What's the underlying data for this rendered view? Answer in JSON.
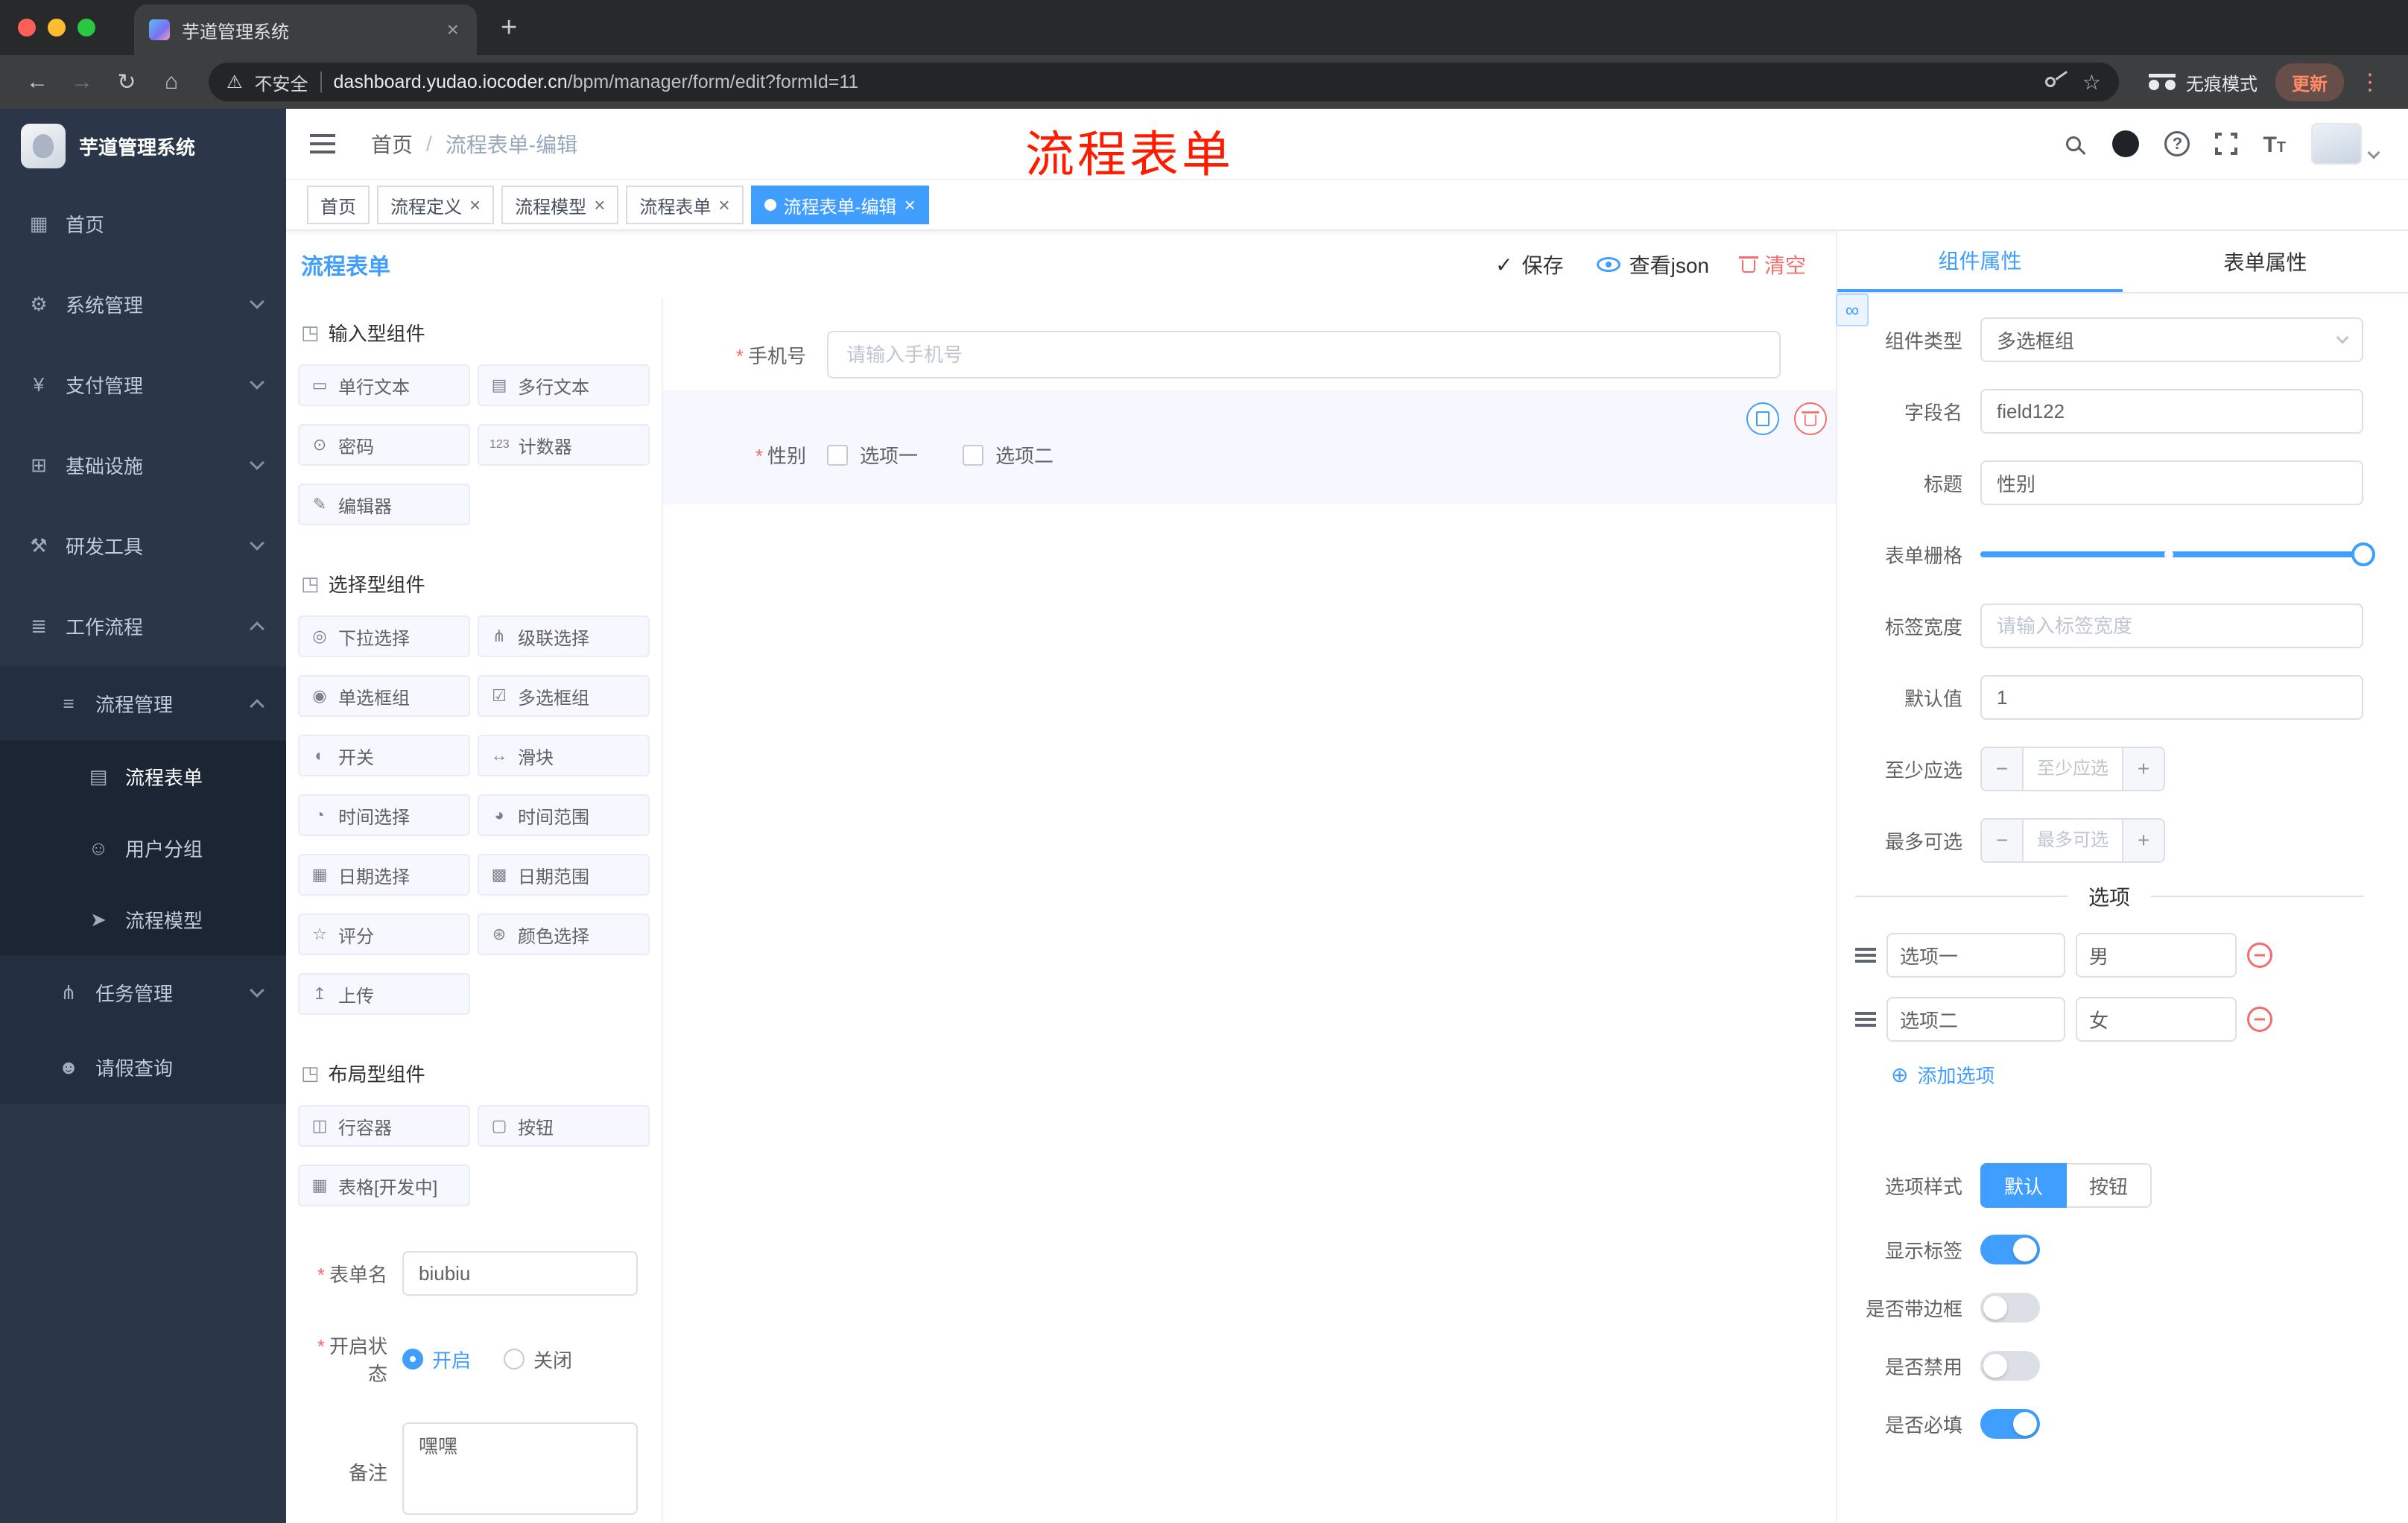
{
  "colors": {
    "accent": "#409EFF",
    "danger": "#F56C6C",
    "annotation_red": "#FE1B00"
  },
  "browser": {
    "tab_title": "芋道管理系统",
    "security_label": "不安全",
    "url_domain": "dashboard.yudao.iocoder.cn",
    "url_path": "/bpm/manager/form/edit?formId=11",
    "incognito_label": "无痕模式",
    "update_label": "更新"
  },
  "sidebar": {
    "brand": "芋道管理系统",
    "items": [
      {
        "label": "首页",
        "glyph": "▦"
      },
      {
        "label": "系统管理",
        "glyph": "⚙"
      },
      {
        "label": "支付管理",
        "glyph": "¥"
      },
      {
        "label": "基础设施",
        "glyph": "⊞"
      },
      {
        "label": "研发工具",
        "glyph": "⚒"
      },
      {
        "label": "工作流程",
        "glyph": "≣"
      },
      {
        "label": "流程管理",
        "glyph": "≡"
      },
      {
        "label": "流程表单",
        "glyph": "▤"
      },
      {
        "label": "用户分组",
        "glyph": "☺"
      },
      {
        "label": "流程模型",
        "glyph": "➤"
      },
      {
        "label": "任务管理",
        "glyph": "⋔"
      },
      {
        "label": "请假查询",
        "glyph": "☻"
      }
    ]
  },
  "header": {
    "breadcrumb_home": "首页",
    "breadcrumb_current": "流程表单-编辑",
    "annotation": "流程表单"
  },
  "tags": [
    {
      "label": "首页"
    },
    {
      "label": "流程定义"
    },
    {
      "label": "流程模型"
    },
    {
      "label": "流程表单"
    },
    {
      "label": "流程表单-编辑"
    }
  ],
  "designer": {
    "title": "流程表单",
    "save_label": "保存",
    "view_json_label": "查看json",
    "clear_label": "清空",
    "groups": [
      {
        "title": "输入型组件",
        "items": [
          {
            "label": "单行文本",
            "glyph": "▭"
          },
          {
            "label": "多行文本",
            "glyph": "▤"
          },
          {
            "label": "密码",
            "glyph": "⊙"
          },
          {
            "label": "计数器",
            "glyph": "123"
          },
          {
            "label": "编辑器",
            "glyph": "✎"
          }
        ]
      },
      {
        "title": "选择型组件",
        "items": [
          {
            "label": "下拉选择",
            "glyph": "◎"
          },
          {
            "label": "级联选择",
            "glyph": "⋔"
          },
          {
            "label": "单选框组",
            "glyph": "◉"
          },
          {
            "label": "多选框组",
            "glyph": "☑"
          },
          {
            "label": "开关",
            "glyph": "◐"
          },
          {
            "label": "滑块",
            "glyph": "↔"
          },
          {
            "label": "时间选择",
            "glyph": "◔"
          },
          {
            "label": "时间范围",
            "glyph": "◕"
          },
          {
            "label": "日期选择",
            "glyph": "▦"
          },
          {
            "label": "日期范围",
            "glyph": "▩"
          },
          {
            "label": "评分",
            "glyph": "☆"
          },
          {
            "label": "颜色选择",
            "glyph": "⊛"
          },
          {
            "label": "上传",
            "glyph": "↥"
          }
        ]
      },
      {
        "title": "布局型组件",
        "items": [
          {
            "label": "行容器",
            "glyph": "◫"
          },
          {
            "label": "按钮",
            "glyph": "▢"
          },
          {
            "label": "表格[开发中]",
            "glyph": "▦"
          }
        ]
      }
    ],
    "meta": {
      "name_label": "表单名",
      "name_value": "biubiu",
      "status_label": "开启状态",
      "status_on": "开启",
      "status_off": "关闭",
      "remark_label": "备注",
      "remark_value": "嘿嘿"
    },
    "canvas": {
      "phone_label": "手机号",
      "phone_placeholder": "请输入手机号",
      "gender_label": "性别",
      "gender_option1": "选项一",
      "gender_option2": "选项二"
    }
  },
  "props": {
    "tab_component": "组件属性",
    "tab_form": "表单属性",
    "component_type_label": "组件类型",
    "component_type_value": "多选框组",
    "field_name_label": "字段名",
    "field_name_value": "field122",
    "title_label": "标题",
    "title_value": "性别",
    "grid_label": "表单栅格",
    "label_width_label": "标签宽度",
    "label_width_placeholder": "请输入标签宽度",
    "default_label": "默认值",
    "default_value": "1",
    "min_label": "至少应选",
    "min_placeholder": "至少应选",
    "max_label": "最多可选",
    "max_placeholder": "最多可选",
    "options_title": "选项",
    "option_rows": [
      {
        "label": "选项一",
        "value": "男"
      },
      {
        "label": "选项二",
        "value": "女"
      }
    ],
    "add_option_label": "添加选项",
    "style_label": "选项样式",
    "style_default": "默认",
    "style_button": "按钮",
    "toggle_show_label": "显示标签",
    "toggle_border": "是否带边框",
    "toggle_disabled": "是否禁用",
    "toggle_required": "是否必填"
  }
}
